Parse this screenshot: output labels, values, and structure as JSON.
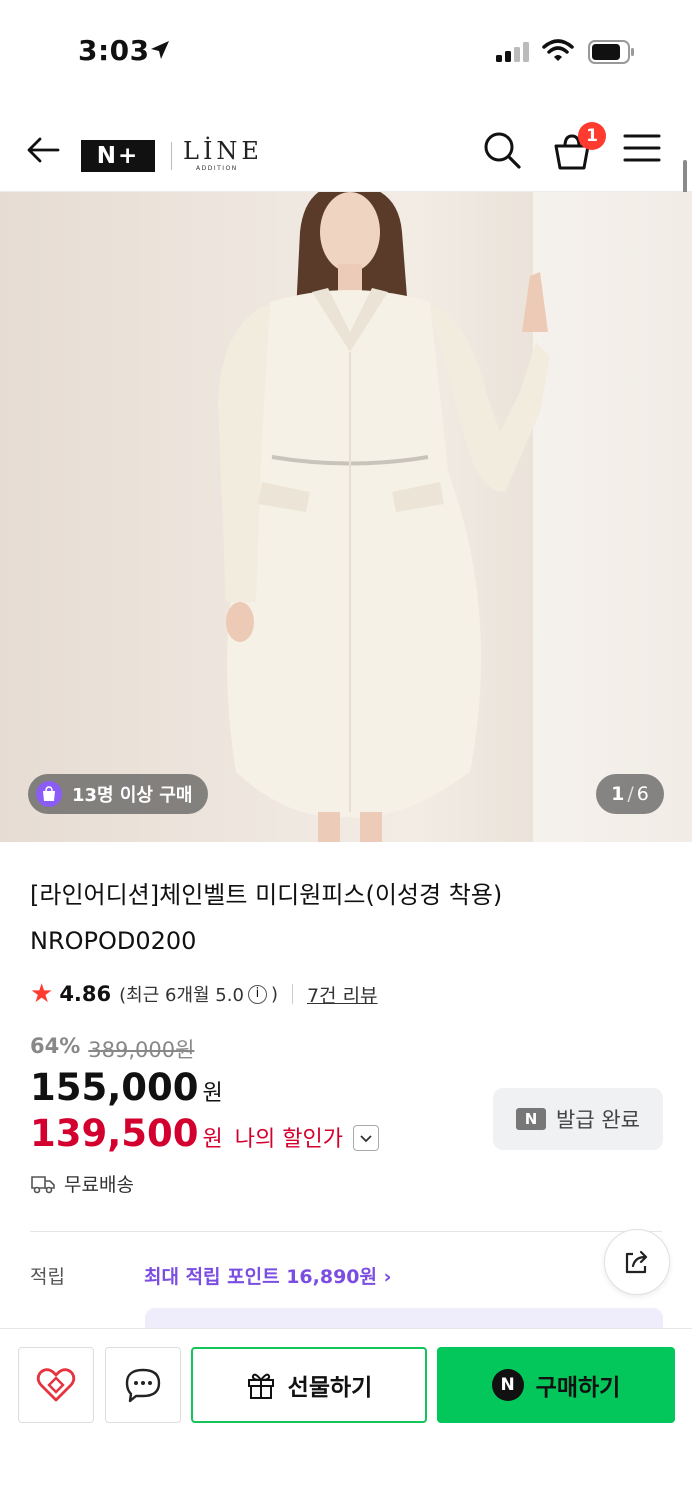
{
  "status_bar": {
    "time": "3:03"
  },
  "header": {
    "logo_mark": "N+",
    "logo_brand": "LİNE",
    "logo_sub": "ADDITION",
    "cart_count": "1"
  },
  "gallery": {
    "buyers_badge": "13명 이상 구매",
    "current": "1",
    "separator": "/",
    "total": "6"
  },
  "product": {
    "title": "[라인어디션]체인벨트 미디원피스(이성경 착용) NROPOD0200",
    "rating": "4.86",
    "rating_recent": "(최근 6개월 5.0",
    "rating_close": ")",
    "info_glyph": "i",
    "review_link": "7건 리뷰",
    "discount_rate": "64%",
    "original_price": "389,000원",
    "price": "155,000",
    "price_unit": "원",
    "my_price": "139,500",
    "my_price_unit": "원",
    "my_price_label": "나의 할인가",
    "coupon_mark": "N",
    "coupon_button": "발급 완료",
    "shipping": "무료배송",
    "points_label": "적립",
    "points_value": "최대 적립 포인트 16,890원 ›"
  },
  "bottom_bar": {
    "gift_button": "선물하기",
    "buy_mark": "N",
    "buy_button": "구매하기"
  },
  "colors": {
    "accent_red": "#d3002f",
    "naver_green": "#03c75a",
    "points_purple": "#7b4de0",
    "badge_red": "#ff3b30"
  }
}
